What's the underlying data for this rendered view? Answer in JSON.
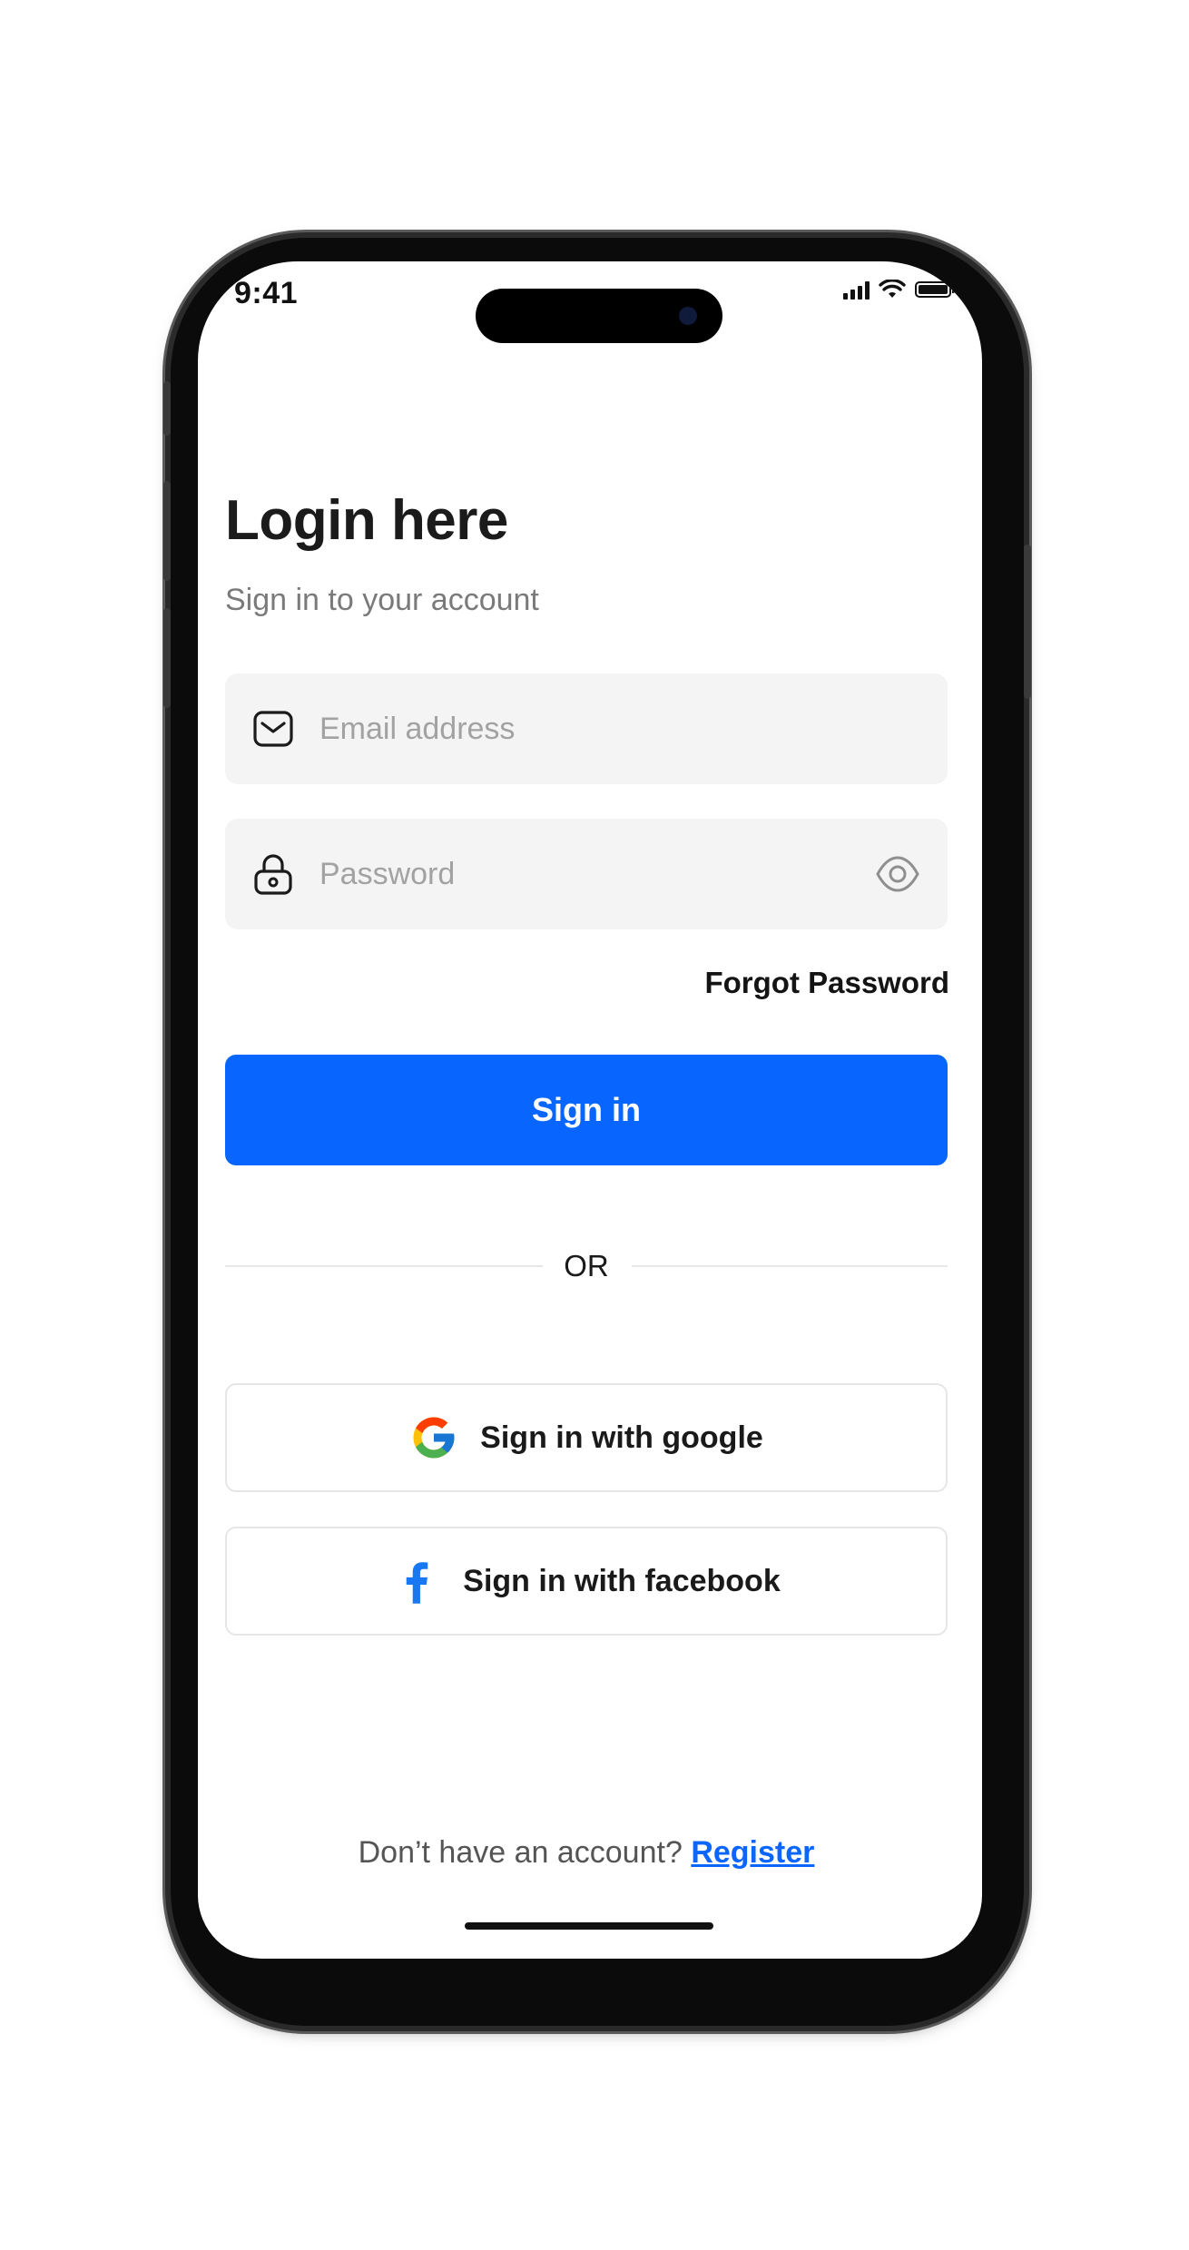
{
  "status_bar": {
    "time": "9:41"
  },
  "login": {
    "title": "Login here",
    "subtitle": "Sign in to your account",
    "email_placeholder": "Email address",
    "password_placeholder": "Password",
    "forgot_password": "Forgot Password",
    "sign_in": "Sign in",
    "divider_text": "OR",
    "google_button": "Sign in with google",
    "facebook_button": "Sign in with facebook",
    "no_account_text": "Don’t have an account?",
    "register_link": "Register"
  },
  "icons": {
    "email": "envelope-icon",
    "password": "lock-icon",
    "show_password": "eye-icon",
    "google": "google-logo-icon",
    "facebook": "facebook-logo-icon"
  },
  "colors": {
    "primary": "#0866ff",
    "field_background": "#f4f4f4",
    "link": "#0a66ff"
  }
}
